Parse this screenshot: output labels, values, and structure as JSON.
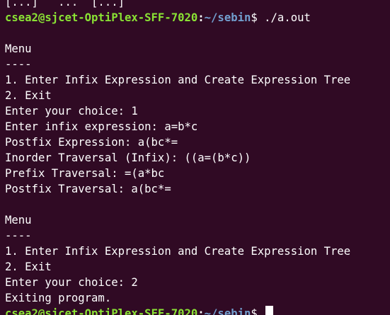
{
  "colors": {
    "background": "#300a24",
    "text": "#ffffff",
    "prompt_user": "#8ae234",
    "prompt_path": "#729fcf"
  },
  "top_partial": "[...]   ...  [...]",
  "prompt1": {
    "user_host": "csea2@sjcet-OptiPlex-SFF-7020",
    "sep": ":",
    "path": "~/sebin",
    "symbol": "$",
    "command": " ./a.out"
  },
  "output": [
    "",
    "Menu",
    "----",
    "1. Enter Infix Expression and Create Expression Tree",
    "2. Exit",
    "Enter your choice: 1",
    "Enter infix expression: a=b*c",
    "Postfix Expression: a(bc*=",
    "Inorder Traversal (Infix): ((a=(b*c))",
    "Prefix Traversal: =(a*bc",
    "Postfix Traversal: a(bc*=",
    "",
    "Menu",
    "----",
    "1. Enter Infix Expression and Create Expression Tree",
    "2. Exit",
    "Enter your choice: 2",
    "Exiting program."
  ],
  "prompt2": {
    "user_host": "csea2@sjcet-OptiPlex-SFF-7020",
    "sep": ":",
    "path": "~/sebin",
    "symbol": "$",
    "command": " "
  }
}
